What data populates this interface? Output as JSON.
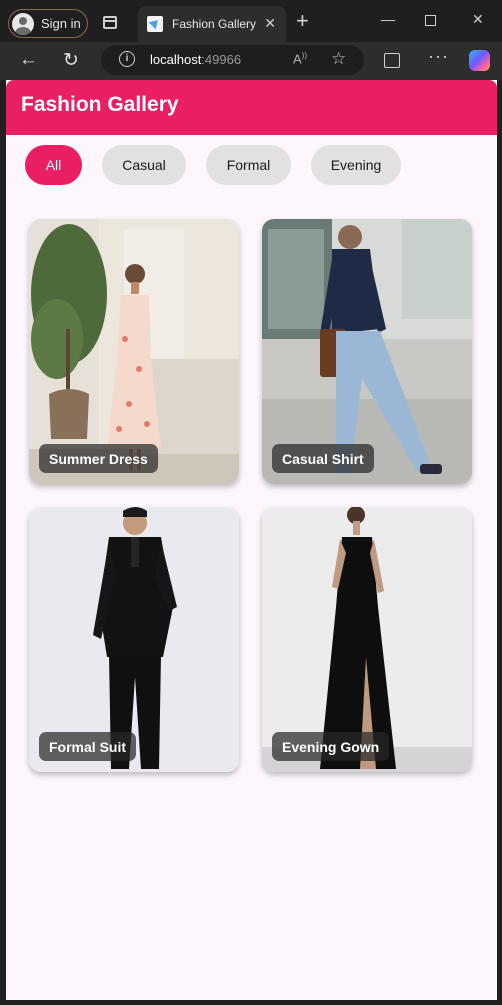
{
  "browser": {
    "signin_label": "Sign in",
    "tab_title": "Fashion Gallery",
    "url_host": "localhost",
    "url_port": ":49966"
  },
  "app": {
    "title": "Fashion Gallery",
    "accent_color": "#e91e63",
    "filters": [
      "All",
      "Casual",
      "Formal",
      "Evening"
    ],
    "selected_filter": "All",
    "items": [
      {
        "label": "Summer Dress"
      },
      {
        "label": "Casual Shirt"
      },
      {
        "label": "Formal Suit"
      },
      {
        "label": "Evening Gown"
      }
    ]
  }
}
